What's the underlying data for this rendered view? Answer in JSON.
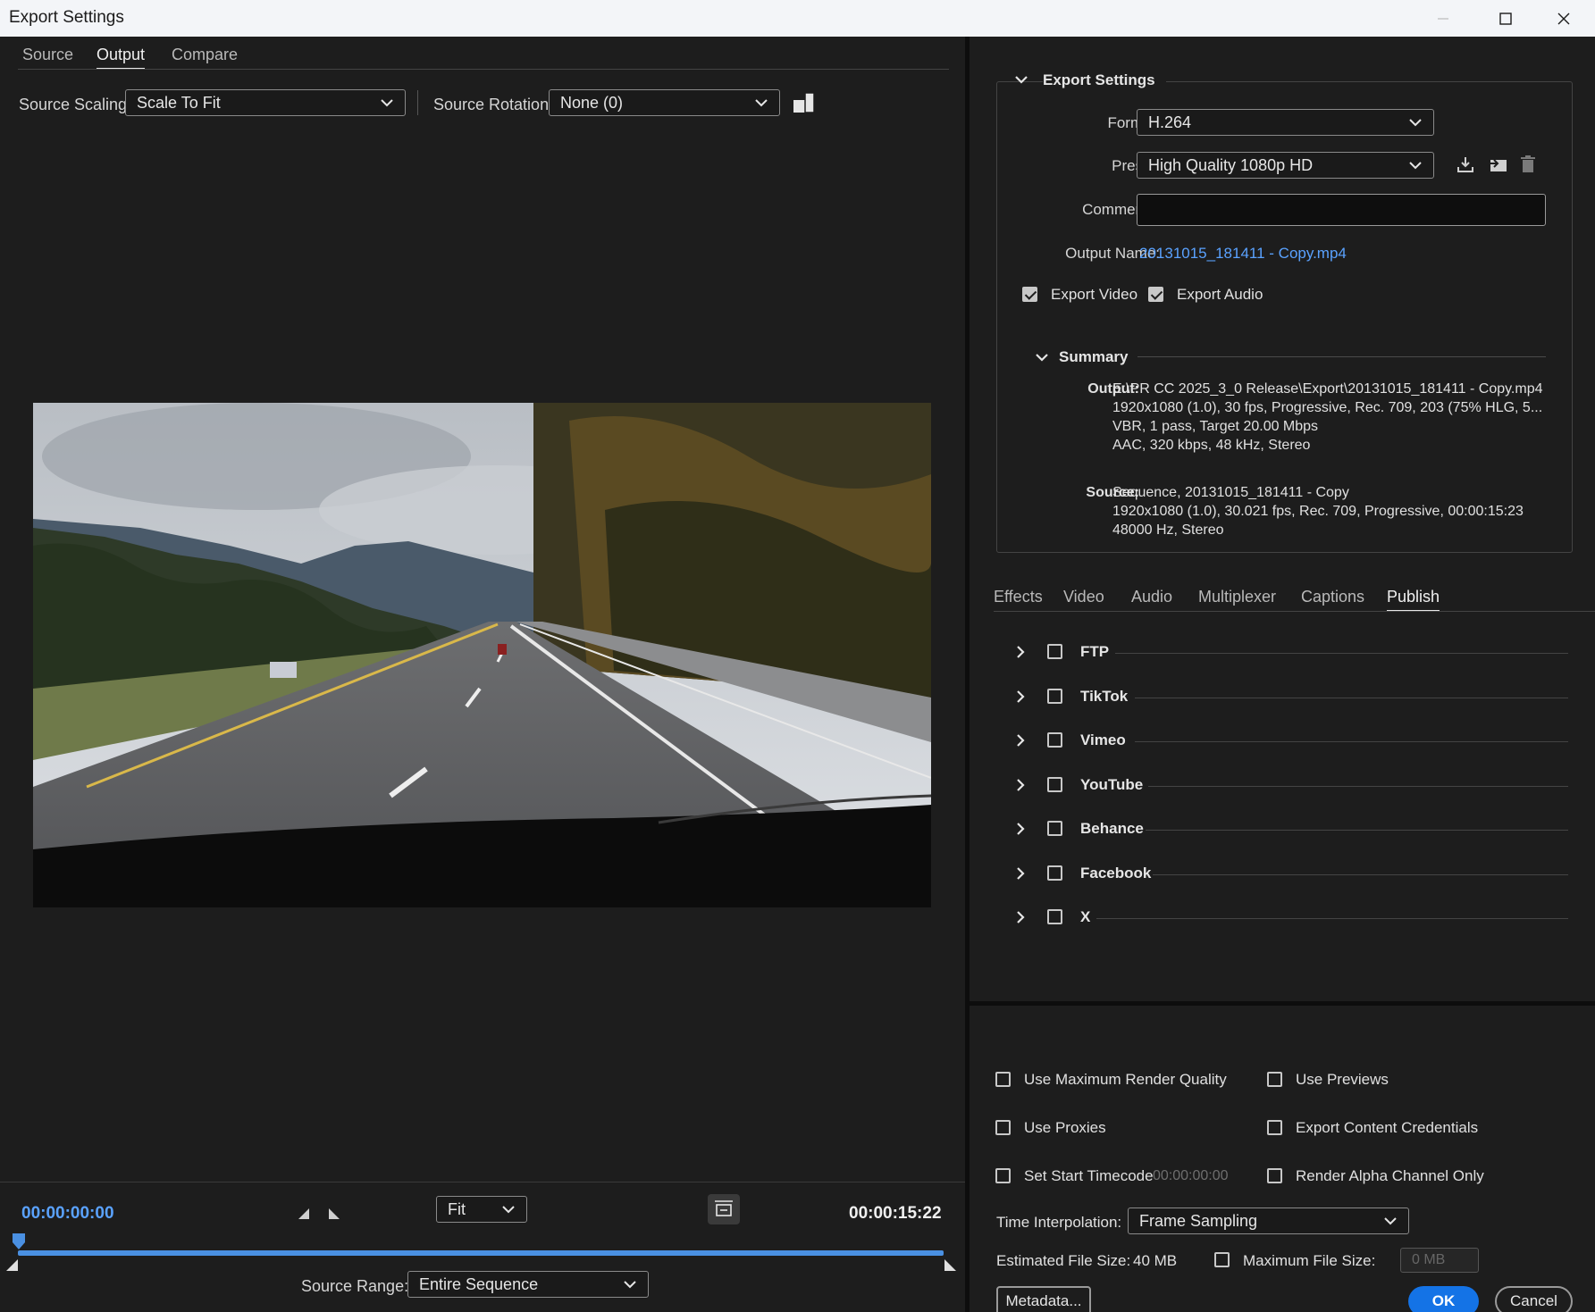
{
  "window": {
    "title": "Export Settings"
  },
  "left_tabs": [
    {
      "label": "Source",
      "active": false
    },
    {
      "label": "Output",
      "active": true
    },
    {
      "label": "Compare",
      "active": false
    }
  ],
  "source_scaling": {
    "label": "Source Scaling:",
    "value": "Scale To Fit"
  },
  "source_rotation": {
    "label": "Source Rotation:",
    "value": "None (0)"
  },
  "timeline": {
    "current_time": "00:00:00:00",
    "end_time": "00:00:15:22",
    "zoom": "Fit",
    "source_range_label": "Source Range:",
    "source_range_value": "Entire Sequence",
    "playhead_fraction": 0.0,
    "accent_color": "#4a90e2"
  },
  "export_settings": {
    "title": "Export Settings",
    "format_label": "Format:",
    "format_value": "H.264",
    "preset_label": "Preset:",
    "preset_value": "High Quality 1080p HD",
    "comments_label": "Comments:",
    "comments_value": "",
    "output_name_label": "Output Name:",
    "output_name_value": "20131015_181411 - Copy.mp4",
    "export_video_label": "Export Video",
    "export_video_checked": true,
    "export_audio_label": "Export Audio",
    "export_audio_checked": true
  },
  "summary": {
    "title": "Summary",
    "output_key": "Output:",
    "output_lines": [
      "E:\\PR CC 2025_3_0 Release\\Export\\20131015_181411 - Copy.mp4",
      "1920x1080 (1.0), 30 fps, Progressive, Rec. 709, 203 (75% HLG, 5...",
      "VBR, 1 pass, Target 20.00 Mbps",
      "AAC, 320 kbps, 48 kHz, Stereo"
    ],
    "source_key": "Source:",
    "source_lines": [
      "Sequence, 20131015_181411 - Copy",
      "1920x1080 (1.0), 30.021 fps, Rec. 709, Progressive, 00:00:15:23",
      "48000 Hz, Stereo"
    ]
  },
  "right_tabs": [
    {
      "label": "Effects",
      "active": false
    },
    {
      "label": "Video",
      "active": false
    },
    {
      "label": "Audio",
      "active": false
    },
    {
      "label": "Multiplexer",
      "active": false
    },
    {
      "label": "Captions",
      "active": false
    },
    {
      "label": "Publish",
      "active": true
    }
  ],
  "publish_targets": [
    "FTP",
    "TikTok",
    "Vimeo",
    "YouTube",
    "Behance",
    "Facebook",
    "X"
  ],
  "options": {
    "max_render_quality": "Use Maximum Render Quality",
    "use_previews": "Use Previews",
    "use_proxies": "Use Proxies",
    "export_credentials": "Export Content Credentials",
    "set_start_timecode": "Set Start Timecode",
    "start_timecode_value": "00:00:00:00",
    "render_alpha": "Render Alpha Channel Only",
    "time_interpolation_label": "Time Interpolation:",
    "time_interpolation_value": "Frame Sampling",
    "estimated_size_label": "Estimated File Size:",
    "estimated_size_value": "40 MB",
    "max_file_size_label": "Maximum File Size:",
    "max_file_size_value": "0 MB"
  },
  "buttons": {
    "metadata": "Metadata...",
    "ok": "OK",
    "cancel": "Cancel"
  }
}
